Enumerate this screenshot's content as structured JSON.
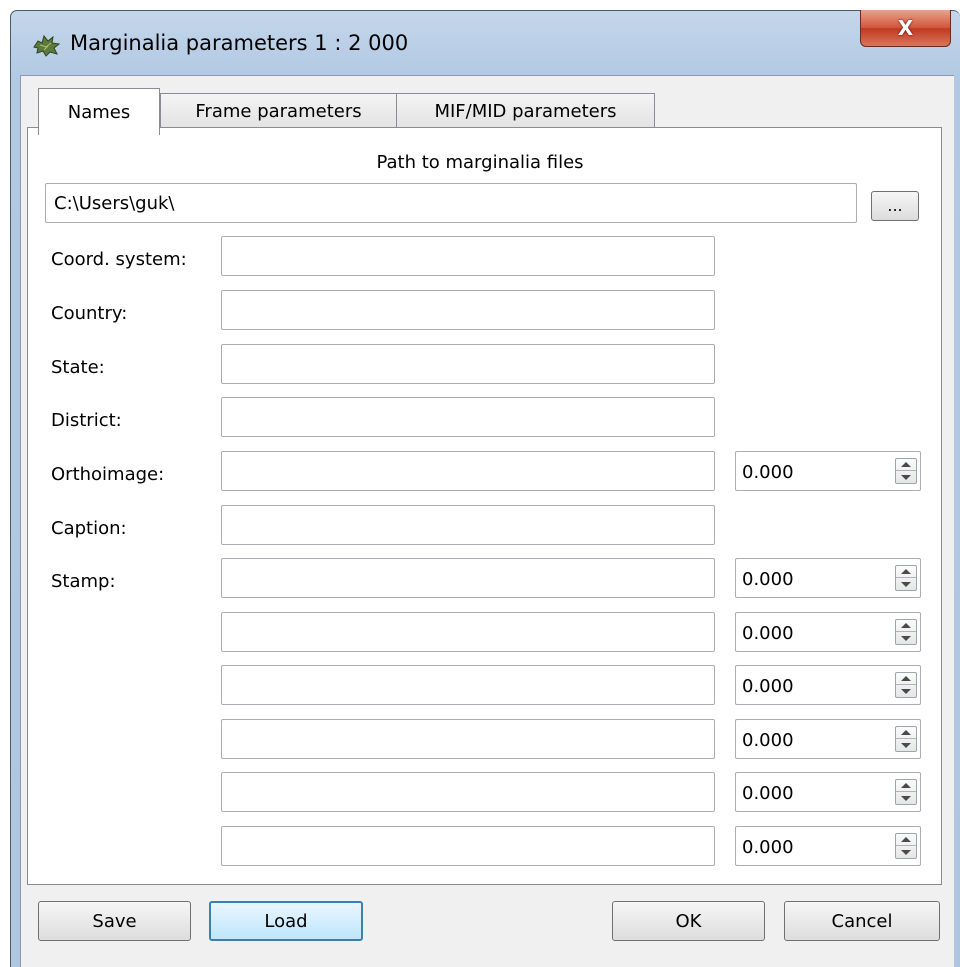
{
  "window": {
    "title": "Marginalia parameters 1 : 2 000",
    "close_glyph": "X",
    "icon": "map-leaf-icon"
  },
  "tabs": [
    {
      "label": "Names",
      "active": true
    },
    {
      "label": "Frame parameters",
      "active": false
    },
    {
      "label": "MIF/MID parameters",
      "active": false
    }
  ],
  "names": {
    "path_title": "Path to marginalia files",
    "path_value": "C:\\Users\\guk\\",
    "browse_label": "...",
    "fields": {
      "coord_system": {
        "label": "Coord. system:",
        "value": ""
      },
      "country": {
        "label": "Country:",
        "value": ""
      },
      "state": {
        "label": "State:",
        "value": ""
      },
      "district": {
        "label": "District:",
        "value": ""
      },
      "orthoimage": {
        "label": "Orthoimage:",
        "value": "",
        "number": "0.000"
      },
      "caption": {
        "label": "Caption:",
        "value": ""
      },
      "stamp": {
        "label": "Stamp:"
      }
    },
    "stamps": [
      {
        "value": "",
        "number": "0.000"
      },
      {
        "value": "",
        "number": "0.000"
      },
      {
        "value": "",
        "number": "0.000"
      },
      {
        "value": "",
        "number": "0.000"
      },
      {
        "value": "",
        "number": "0.000"
      },
      {
        "value": "",
        "number": "0.000"
      }
    ]
  },
  "buttons": {
    "save": "Save",
    "load": "Load",
    "ok": "OK",
    "cancel": "Cancel"
  }
}
